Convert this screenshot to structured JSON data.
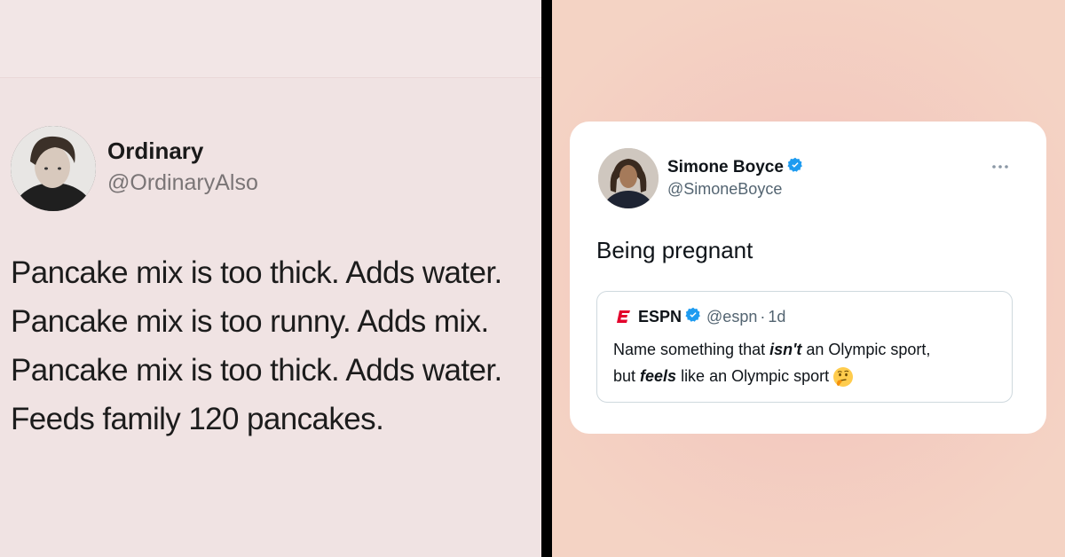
{
  "left_tweet": {
    "name": "Ordinary",
    "handle": "@OrdinaryAlso",
    "lines": [
      "Pancake mix is too thick. Adds water.",
      "Pancake mix is too runny. Adds mix.",
      "Pancake mix is too thick. Adds water.",
      "Feeds family 120 pancakes."
    ]
  },
  "right_tweet": {
    "name": "Simone Boyce",
    "handle": "@SimoneBoyce",
    "text": "Being pregnant",
    "quote": {
      "name": "ESPN",
      "handle": "@espn",
      "separator": "·",
      "time": "1d",
      "line1_pre": "Name something that ",
      "line1_em": "isn't",
      "line1_post": " an Olympic sport,",
      "line2_pre": "but ",
      "line2_em": "feels",
      "line2_post": " like an Olympic sport"
    }
  },
  "colors": {
    "verified": "#1d9bf0",
    "espn_red": "#e3002b"
  },
  "icons": [
    "verified-badge-icon",
    "more-options-icon",
    "espn-logo-icon",
    "thinking-face-emoji-icon"
  ]
}
